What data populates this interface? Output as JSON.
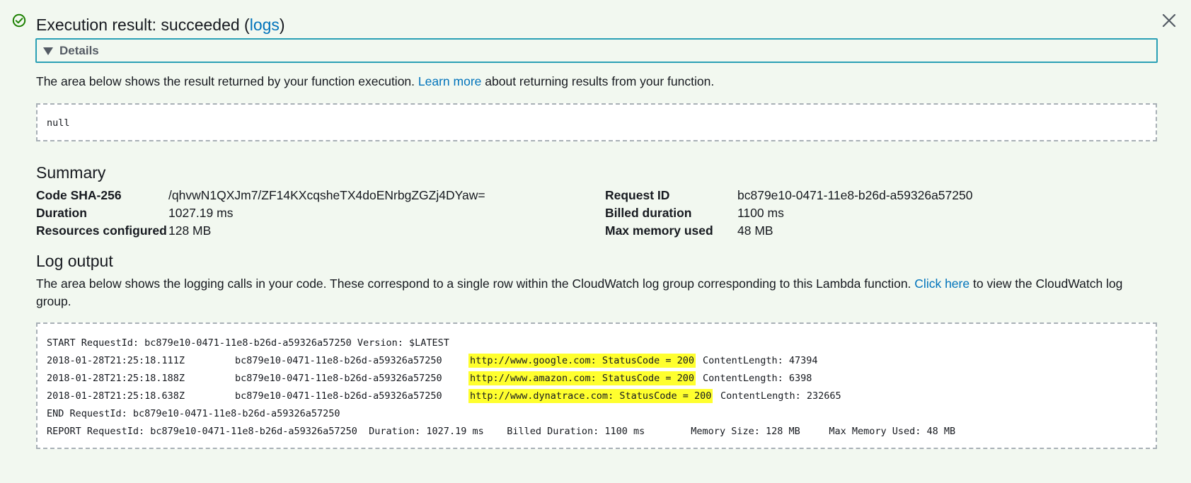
{
  "header": {
    "title_prefix": "Execution result: succeeded (",
    "logs_link": "logs",
    "title_suffix": ")"
  },
  "details": {
    "label": "Details"
  },
  "result_section": {
    "text_before": "The area below shows the result returned by your function execution.",
    "link": "Learn more",
    "text_after": "about returning results from your function.",
    "result_value": "null"
  },
  "summary": {
    "title": "Summary",
    "left": [
      {
        "label": "Code SHA-256",
        "value": "/qhvwN1QXJm7/ZF14KXcqsheTX4doENrbgZGZj4DYaw="
      },
      {
        "label": "Duration",
        "value": "1027.19 ms"
      },
      {
        "label": "Resources configured",
        "value": "128 MB"
      }
    ],
    "right": [
      {
        "label": "Request ID",
        "value": "bc879e10-0471-11e8-b26d-a59326a57250"
      },
      {
        "label": "Billed duration",
        "value": "1100 ms"
      },
      {
        "label": "Max memory used",
        "value": "48 MB"
      }
    ]
  },
  "log_output": {
    "title": "Log output",
    "text_before": "The area below shows the logging calls in your code. These correspond to a single row within the CloudWatch log group corresponding to this Lambda function.",
    "link": "Click here",
    "text_after": "to view the CloudWatch log group.",
    "start_line": "START RequestId: bc879e10-0471-11e8-b26d-a59326a57250 Version: $LATEST",
    "entries": [
      {
        "timestamp": "2018-01-28T21:25:18.111Z",
        "request_id": "bc879e10-0471-11e8-b26d-a59326a57250",
        "message": "http://www.google.com: StatusCode = 200",
        "content_length": "ContentLength: 47394"
      },
      {
        "timestamp": "2018-01-28T21:25:18.188Z",
        "request_id": "bc879e10-0471-11e8-b26d-a59326a57250",
        "message": "http://www.amazon.com: StatusCode = 200",
        "content_length": "ContentLength: 6398"
      },
      {
        "timestamp": "2018-01-28T21:25:18.638Z",
        "request_id": "bc879e10-0471-11e8-b26d-a59326a57250",
        "message": "http://www.dynatrace.com: StatusCode = 200",
        "content_length": "ContentLength: 232665"
      }
    ],
    "end_line": "END RequestId: bc879e10-0471-11e8-b26d-a59326a57250",
    "report_line": "REPORT RequestId: bc879e10-0471-11e8-b26d-a59326a57250  Duration: 1027.19 ms    Billed Duration: 1100 ms        Memory Size: 128 MB     Max Memory Used: 48 MB"
  },
  "colors": {
    "background": "#f2f8f0",
    "link": "#0073bb",
    "success": "#1d8102",
    "highlight": "#ffff2e",
    "details_border": "#2aa0b5"
  },
  "icons": {
    "status": "check-circle-icon",
    "close": "close-icon",
    "expand": "caret-down-icon"
  }
}
